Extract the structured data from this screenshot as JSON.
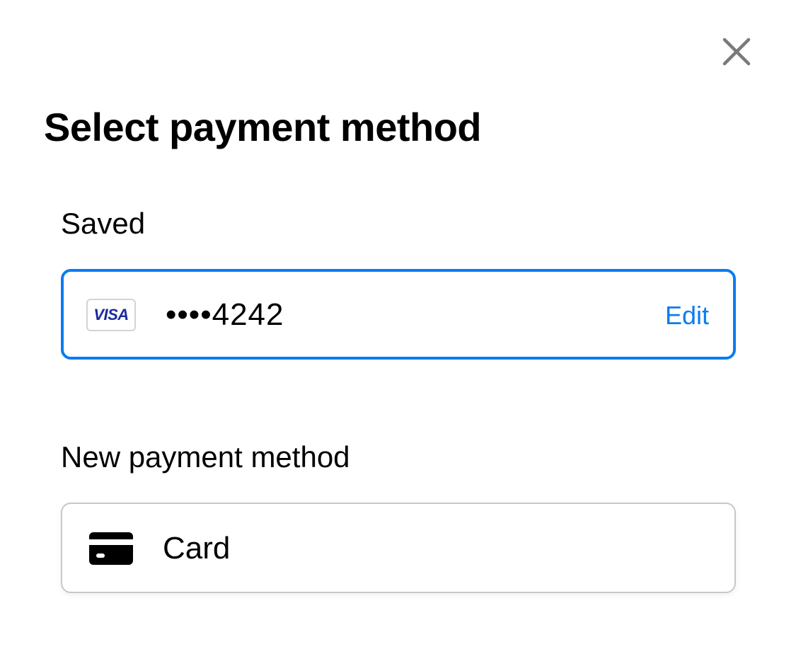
{
  "dialog": {
    "title": "Select payment method",
    "close_icon": "close-icon"
  },
  "saved": {
    "heading": "Saved",
    "card": {
      "brand": "VISA",
      "masked_number": "••••4242",
      "edit_label": "Edit",
      "selected": true
    }
  },
  "new_method": {
    "heading": "New payment method",
    "options": [
      {
        "label": "Card",
        "icon": "credit-card-icon"
      }
    ]
  },
  "colors": {
    "accent": "#0a7cf0",
    "visa_brand": "#1a2a9c",
    "close_icon": "#7a7a7a",
    "border_default": "#c8c8c8"
  }
}
